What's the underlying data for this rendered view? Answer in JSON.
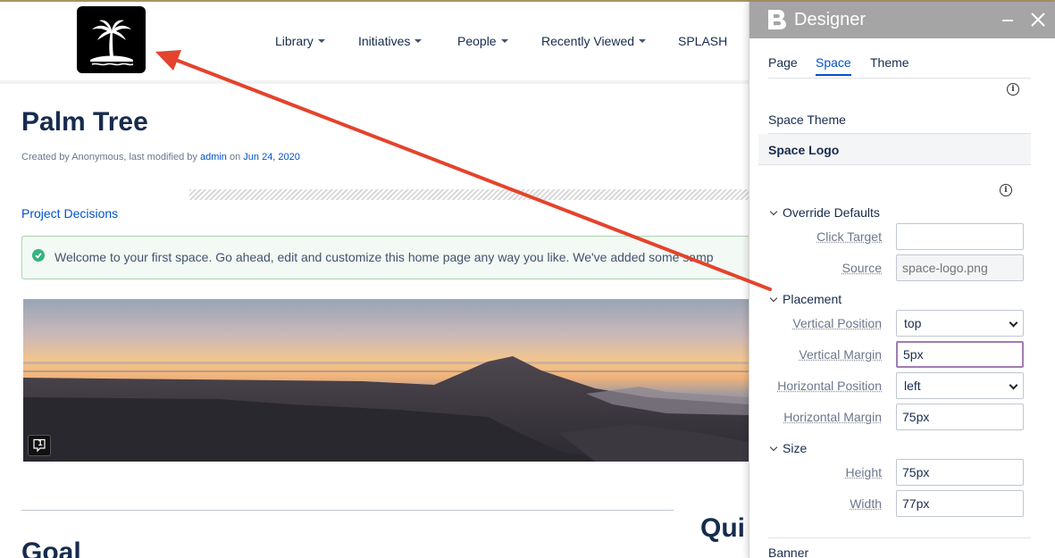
{
  "nav": {
    "items": [
      {
        "label": "Library",
        "dropdown": true
      },
      {
        "label": "Initiatives",
        "dropdown": true
      },
      {
        "label": "People",
        "dropdown": true
      },
      {
        "label": "Recently Viewed",
        "dropdown": true
      },
      {
        "label": "SPLASH",
        "dropdown": false
      }
    ]
  },
  "page": {
    "title": "Palm Tree",
    "meta_prefix": "Created by Anonymous, last modified by ",
    "meta_user": "admin",
    "meta_on": " on ",
    "meta_date": "Jun 24, 2020",
    "link": "Project Decisions",
    "info_text": "Welcome to your first space. Go ahead, edit and customize this home page any way you like. We've added some samp",
    "comment_count": "1",
    "goal_heading": "Goal",
    "quick_heading": "Qui"
  },
  "designer": {
    "title": "Designer",
    "tabs": [
      "Page",
      "Space",
      "Theme"
    ],
    "active_tab": "Space",
    "space_theme": "Space Theme",
    "space_logo": "Space Logo",
    "override_defaults": "Override Defaults",
    "click_target_label": "Click Target",
    "click_target_value": "",
    "source_label": "Source",
    "source_placeholder": "space-logo.png",
    "placement": "Placement",
    "vertical_position_label": "Vertical Position",
    "vertical_position_value": "top",
    "vertical_margin_label": "Vertical Margin",
    "vertical_margin_value": "5px",
    "horizontal_position_label": "Horizontal Position",
    "horizontal_position_value": "left",
    "horizontal_margin_label": "Horizontal Margin",
    "horizontal_margin_value": "75px",
    "size": "Size",
    "height_label": "Height",
    "height_value": "75px",
    "width_label": "Width",
    "width_value": "77px",
    "banner": "Banner"
  },
  "colors": {
    "accent": "#0052cc",
    "arrow": "#e4432d",
    "header_bg": "#a5a5a5",
    "success": "#36b37e"
  }
}
